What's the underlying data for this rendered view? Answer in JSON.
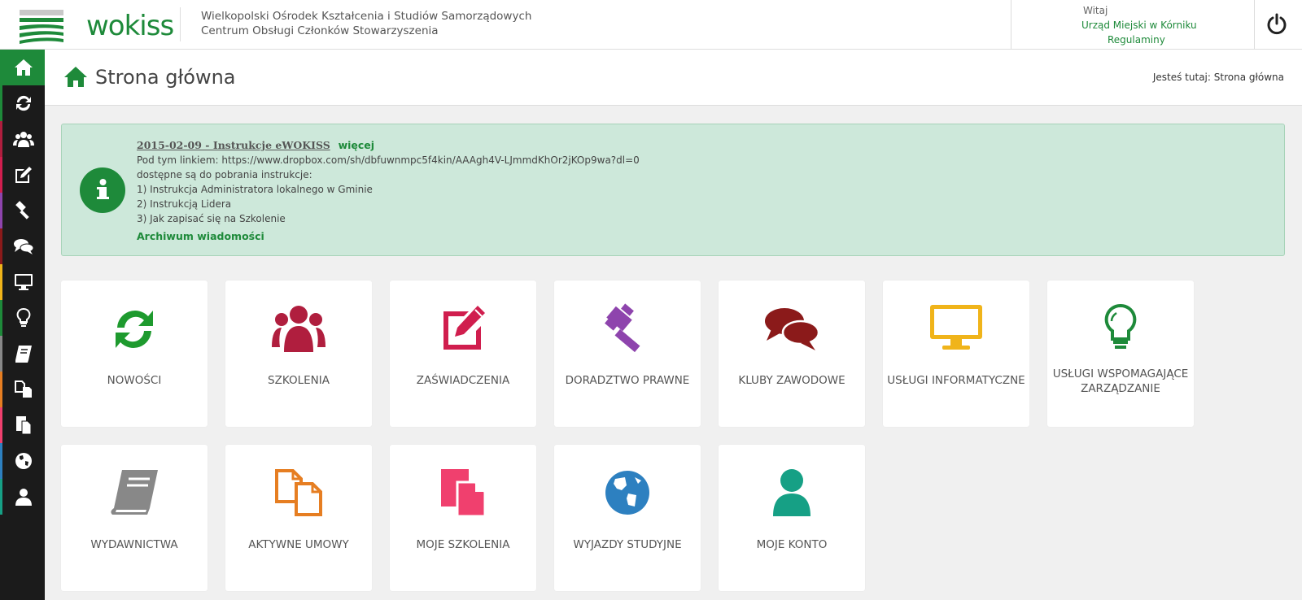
{
  "header": {
    "logo_text": "wokiss",
    "org_line1": "Wielkopolski Ośrodek Kształcenia i Studiów Samorządowych",
    "org_line2": "Centrum Obsługi Członków Stowarzyszenia",
    "greeting": "Witaj",
    "user_name": "Urząd Miejski w Kórniku",
    "regulations_link": "Regulaminy"
  },
  "sidebar": {
    "items": [
      {
        "icon": "home-icon",
        "color": "#1e8a3a"
      },
      {
        "icon": "refresh-icon",
        "color": "#1e8a3a"
      },
      {
        "icon": "users-icon",
        "color": "#b01e3e"
      },
      {
        "icon": "edit-icon",
        "color": "#d01e4e"
      },
      {
        "icon": "gavel-icon",
        "color": "#8e44ad"
      },
      {
        "icon": "comments-icon",
        "color": "#8b1a1a"
      },
      {
        "icon": "desktop-icon",
        "color": "#f0b41a"
      },
      {
        "icon": "lightbulb-icon",
        "color": "#1e8a3a"
      },
      {
        "icon": "book-icon",
        "color": "#888888"
      },
      {
        "icon": "copy-icon",
        "color": "#e67e22"
      },
      {
        "icon": "files-icon",
        "color": "#f0406e"
      },
      {
        "icon": "globe-icon",
        "color": "#2d80c0"
      },
      {
        "icon": "user-icon",
        "color": "#16a085"
      }
    ]
  },
  "page": {
    "title": "Strona główna",
    "breadcrumb_prefix": "Jesteś tutaj:",
    "breadcrumb_current": "Strona główna"
  },
  "info": {
    "title": "2015-02-09 - Instrukcje eWOKISS",
    "more": "więcej",
    "lines": [
      "Pod tym linkiem: https://www.dropbox.com/sh/dbfuwnmpc5f4kin/AAAgh4V-LJmmdKhOr2jKOp9wa?dl=0",
      "dostępne są do pobrania instrukcje:",
      "1) Instrukcja Administratora lokalnego w Gminie",
      "2) Instrukcją Lidera",
      "3) Jak zapisać się na Szkolenie"
    ],
    "archive_link": "Archiwum wiadomości"
  },
  "tiles": [
    {
      "label": "NOWOŚCI",
      "icon": "refresh-icon",
      "color": "#1e9a2e"
    },
    {
      "label": "SZKOLENIA",
      "icon": "users-icon",
      "color": "#b01e3e"
    },
    {
      "label": "ZAŚWIADCZENIA",
      "icon": "edit-icon",
      "color": "#d01e4e"
    },
    {
      "label": "DORADZTWO PRAWNE",
      "icon": "gavel-icon",
      "color": "#8e44ad"
    },
    {
      "label": "KLUBY ZAWODOWE",
      "icon": "comments-icon",
      "color": "#8b1a1a"
    },
    {
      "label": "USŁUGI INFORMATYCZNE",
      "icon": "desktop-icon",
      "color": "#f0b41a"
    },
    {
      "label": "USŁUGI WSPOMAGAJĄCE ZARZĄDZANIE",
      "icon": "lightbulb-icon",
      "color": "#1e8a3a"
    },
    {
      "label": "WYDAWNICTWA",
      "icon": "book-icon",
      "color": "#888888"
    },
    {
      "label": "AKTYWNE UMOWY",
      "icon": "copy-icon",
      "color": "#e67e22"
    },
    {
      "label": "MOJE SZKOLENIA",
      "icon": "files-icon",
      "color": "#f0406e"
    },
    {
      "label": "WYJAZDY STUDYJNE",
      "icon": "globe-icon",
      "color": "#2d80c0"
    },
    {
      "label": "MOJE KONTO",
      "icon": "user-icon",
      "color": "#16a085"
    }
  ]
}
